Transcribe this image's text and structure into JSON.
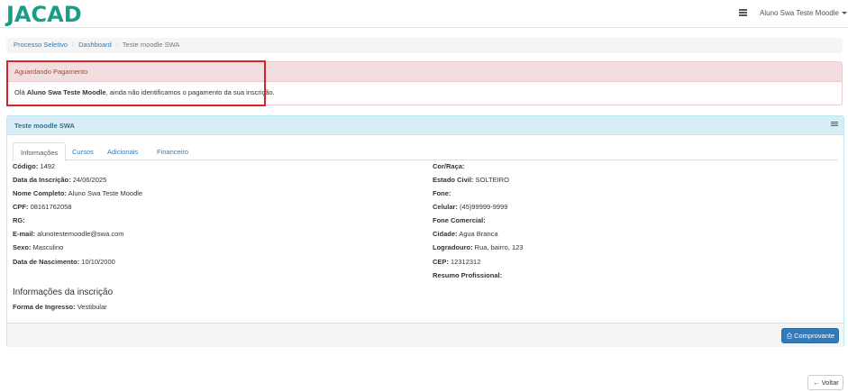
{
  "header": {
    "logo_text": "JACAD",
    "user_name": "Aluno Swa Teste Moodle"
  },
  "breadcrumb": {
    "items": [
      "Processo Seletivo",
      "Dashboard"
    ],
    "active": "Teste moodle SWA"
  },
  "alert": {
    "title": "Aguardando Pagamento",
    "greeting": "Olá ",
    "name": "Aluno Swa Teste Moodle",
    "message": ", ainda não identificamos o pagamento da sua inscrição."
  },
  "panel": {
    "title": "Teste moodle SWA",
    "tabs": [
      "Informações",
      "Cursos",
      "Adicionais",
      "Financeiro"
    ]
  },
  "left_fields": [
    {
      "label": "Código:",
      "value": "1492"
    },
    {
      "label": "Data da Inscrição:",
      "value": "24/06/2025"
    },
    {
      "label": "Nome Completo:",
      "value": "Aluno Swa Teste Moodle"
    },
    {
      "label": "CPF:",
      "value": "08161762058"
    },
    {
      "label": "RG:",
      "value": ""
    },
    {
      "label": "E-mail:",
      "value": "alunotestemoodle@swa.com"
    },
    {
      "label": "Sexo:",
      "value": "Masculino"
    },
    {
      "label": "Data de Nascimento:",
      "value": "10/10/2000"
    }
  ],
  "right_fields": [
    {
      "label": "Cor/Raça:",
      "value": ""
    },
    {
      "label": "Estado Civil:",
      "value": "SOLTEIRO"
    },
    {
      "label": "Fone:",
      "value": ""
    },
    {
      "label": "Celular:",
      "value": "(45)99999-9999"
    },
    {
      "label": "Fone Comercial:",
      "value": ""
    },
    {
      "label": "Cidade:",
      "value": "Agua Branca"
    },
    {
      "label": "Logradouro:",
      "value": "Rua, bairro, 123"
    },
    {
      "label": "CEP:",
      "value": "12312312"
    },
    {
      "label": "Resumo Profissional:",
      "value": ""
    }
  ],
  "inscricao": {
    "title": "Informações da inscrição",
    "label": "Forma de Ingresso:",
    "value": "Vestibular"
  },
  "buttons": {
    "comprovante": "Comprovante",
    "voltar": "Voltar"
  }
}
